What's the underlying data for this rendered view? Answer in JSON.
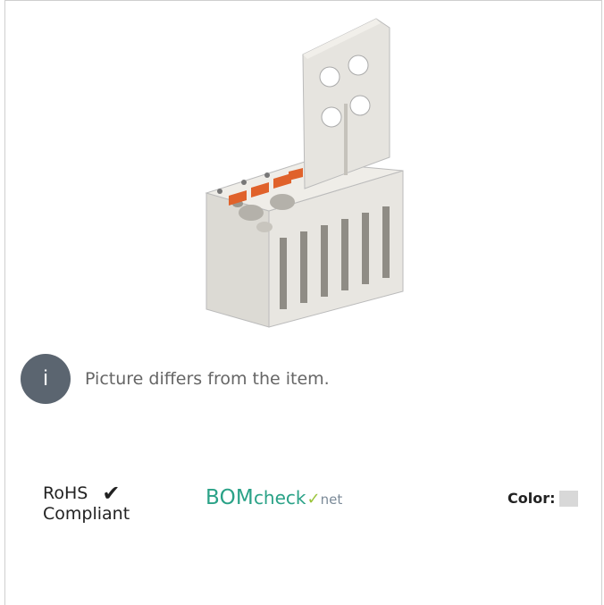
{
  "info": {
    "icon_glyph": "i",
    "message": "Picture differs from the item."
  },
  "rohs": {
    "line1": "RoHS",
    "check": "✔",
    "line2": "Compliant"
  },
  "bomcheck": {
    "part1": "BOM",
    "part2": "check",
    "tick": "✓",
    "part3": "net"
  },
  "color": {
    "label": "Color:",
    "swatch": "#d8d8d8"
  },
  "colors": {
    "body": "#e8e6e1",
    "accent": "#e0622b",
    "info_bg": "#5b6570",
    "brand": "#2aa287"
  }
}
